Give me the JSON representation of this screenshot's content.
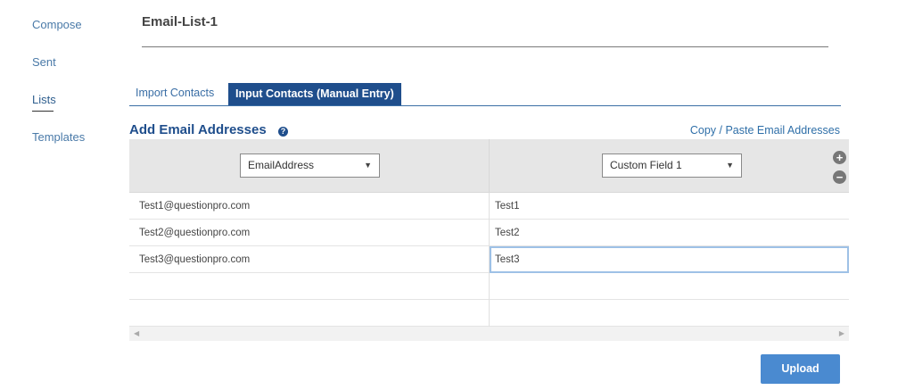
{
  "sidebar": {
    "items": [
      {
        "label": "Compose"
      },
      {
        "label": "Sent"
      },
      {
        "label": "Lists"
      },
      {
        "label": "Templates"
      }
    ]
  },
  "page": {
    "title": "Email-List-1"
  },
  "tabs": [
    {
      "label": "Import Contacts"
    },
    {
      "label": "Input Contacts (Manual Entry)"
    }
  ],
  "section": {
    "title": "Add Email Addresses",
    "help_icon": "?",
    "copy_paste_link": "Copy / Paste Email Addresses"
  },
  "grid": {
    "columns": [
      {
        "selected": "EmailAddress"
      },
      {
        "selected": "Custom Field 1"
      }
    ],
    "rows": [
      [
        "Test1@questionpro.com",
        "Test1"
      ],
      [
        "Test2@questionpro.com",
        "Test2"
      ],
      [
        "Test3@questionpro.com",
        "Test3"
      ],
      [
        "",
        ""
      ],
      [
        "",
        ""
      ]
    ],
    "add_column_icon": "+",
    "remove_column_icon": "−"
  },
  "actions": {
    "upload": "Upload"
  },
  "colors": {
    "accent": "#1f4e8c",
    "button": "#4a8ad0",
    "link": "#2f6fa8"
  }
}
